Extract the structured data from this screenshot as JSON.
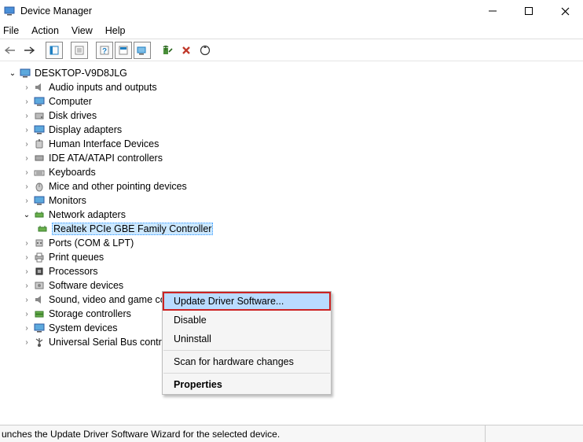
{
  "window": {
    "title": "Device Manager"
  },
  "menu": {
    "file": "File",
    "action": "Action",
    "view": "View",
    "help": "Help"
  },
  "tree": {
    "root": "DESKTOP-V9D8JLG",
    "audio": "Audio inputs and outputs",
    "computer": "Computer",
    "disk": "Disk drives",
    "display": "Display adapters",
    "hid": "Human Interface Devices",
    "ide": "IDE ATA/ATAPI controllers",
    "keyboards": "Keyboards",
    "mice": "Mice and other pointing devices",
    "monitors": "Monitors",
    "network": "Network adapters",
    "realtek": "Realtek PCIe GBE Family Controller",
    "ports": "Ports (COM & LPT)",
    "print": "Print queues",
    "processors": "Processors",
    "softdev": "Software devices",
    "sound": "Sound, video and game cont",
    "storage": "Storage controllers",
    "system": "System devices",
    "usb": "Universal Serial Bus controllers"
  },
  "ctx": {
    "update": "Update Driver Software...",
    "disable": "Disable",
    "uninstall": "Uninstall",
    "scan": "Scan for hardware changes",
    "properties": "Properties"
  },
  "status": {
    "text": "unches the Update Driver Software Wizard for the selected device."
  }
}
